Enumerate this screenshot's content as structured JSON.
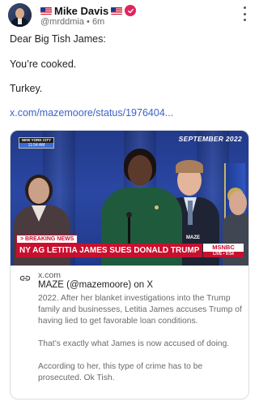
{
  "post": {
    "display_name": "Mike Davis",
    "handle": "@mrddmia",
    "separator": "•",
    "age": "6m",
    "flag_icon": "us-flag-icon",
    "verified_color": "#e0245e",
    "body": {
      "line1": "Dear Big Tish James:",
      "line2": "You’re cooked.",
      "line3": "Turkey.",
      "link": "x.com/mazemoore/status/1976404..."
    }
  },
  "card": {
    "video": {
      "location_bug_top": "NEW YORK CITY",
      "location_bug_time": "11:54 AM",
      "date_tag": "SEPTEMBER 2022",
      "watermark": "MAZE",
      "breaking_label": "> BREAKING NEWS",
      "headline": "NY AG LETITIA JAMES SUES DONALD TRUMP",
      "network": "MSNBC",
      "live_label": "LIVE • 9:54",
      "accent_color": "#c8102e"
    },
    "domain": "x.com",
    "title": "MAZE (@mazemoore) on X",
    "description": [
      "2022. After her blanket investigations into the Trump family and businesses, Letitia James accuses Trump of having lied to get favorable loan conditions.",
      "That’s exactly what James is now accused of doing.",
      "According to her, this type of crime has to be prosecuted. Ok Tish."
    ]
  },
  "colors": {
    "link": "#3e63c7",
    "muted_text": "#6b6b6b"
  }
}
